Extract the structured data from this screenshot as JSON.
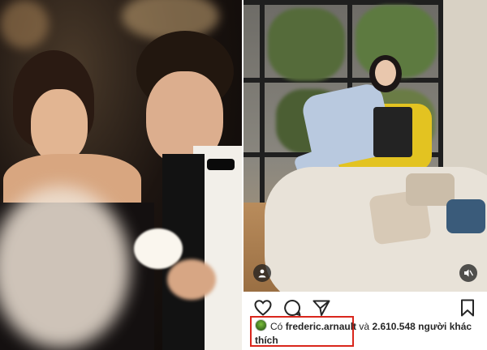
{
  "post": {
    "likes_prefix": "Có",
    "liker_username": "frederic.arnault",
    "likes_and": "và",
    "likes_count": "2.610.548",
    "likes_suffix": "người khác",
    "likes_suffix_line2": "thích"
  },
  "icons": {
    "like": "heart-icon",
    "comment": "comment-icon",
    "share": "send-icon",
    "save": "bookmark-icon",
    "tags": "user-tag-icon",
    "mute": "mute-icon"
  },
  "colors": {
    "highlight_box": "#d9261c",
    "text": "#262626"
  }
}
